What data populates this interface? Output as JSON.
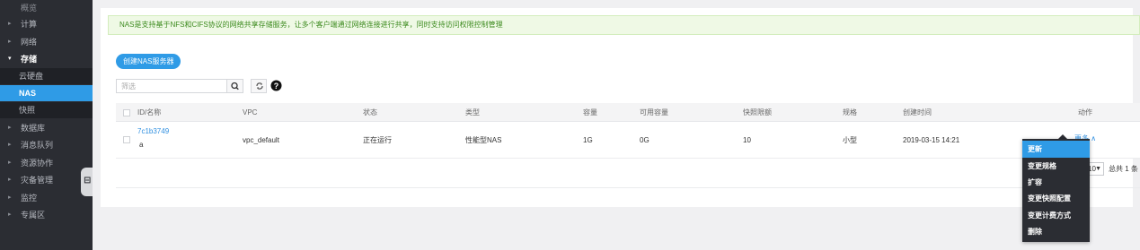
{
  "sidebar": {
    "items": [
      {
        "label": "概览",
        "caret": ""
      },
      {
        "label": "计算",
        "caret": "▸"
      },
      {
        "label": "网络",
        "caret": "▸"
      },
      {
        "label": "存储",
        "caret": "▾"
      },
      {
        "label": "云硬盘",
        "caret": ""
      },
      {
        "label": "NAS",
        "caret": ""
      },
      {
        "label": "快照",
        "caret": ""
      },
      {
        "label": "数据库",
        "caret": "▸"
      },
      {
        "label": "消息队列",
        "caret": "▸"
      },
      {
        "label": "资源协作",
        "caret": "▸"
      },
      {
        "label": "灾备管理",
        "caret": "▸"
      },
      {
        "label": "监控",
        "caret": "▸"
      },
      {
        "label": "专属区",
        "caret": "▸"
      }
    ],
    "active_item": "NAS"
  },
  "notice": {
    "text": "NAS是支持基于NFS和CIFS协议的网络共享存储服务，让多个客户端通过网络连接进行共享，同时支持访问权限控制管理"
  },
  "toolbar": {
    "create_label": "创建NAS服务器",
    "search_placeholder": "筛选",
    "search_icon": "search-icon",
    "refresh_icon": "refresh-icon",
    "help_icon": "help-icon"
  },
  "table": {
    "headers": [
      "ID/名称",
      "VPC",
      "状态",
      "类型",
      "容量",
      "可用容量",
      "快照限额",
      "规格",
      "创建时间",
      "动作"
    ],
    "rows": [
      {
        "id": "7c1b3749",
        "name": "a",
        "vpc": "vpc_default",
        "status": "正在运行",
        "type": "性能型NAS",
        "capacity": "1G",
        "available": "0G",
        "snapshot_quota": "10",
        "spec": "小型",
        "created": "2019-03-15 14:21",
        "action": "更多 ∧"
      }
    ]
  },
  "pagination": {
    "page_size": "10",
    "total": "总共 1 条"
  },
  "action_menu": {
    "items": [
      "更新",
      "变更规格",
      "扩容",
      "变更快照配置",
      "变更计费方式",
      "删除"
    ],
    "highlighted": "更新"
  },
  "colors": {
    "sidebar_bg": "#2b2d33",
    "accent": "#2f9be6",
    "notice_bg": "#eff9e5",
    "notice_text": "#3d8b1f"
  }
}
